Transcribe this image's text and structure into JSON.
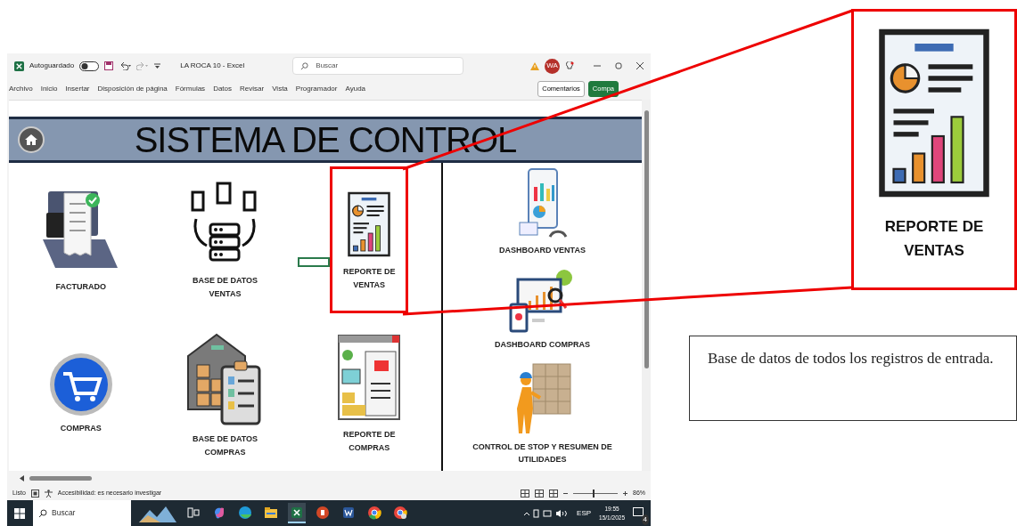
{
  "title_bar": {
    "autosave_label": "Autoguardado",
    "autosave_on": false,
    "document_title": "LA ROCA 10 - Excel",
    "search_placeholder": "Buscar",
    "avatar_initials": "WA"
  },
  "ribbon": {
    "tabs": [
      "Archivo",
      "Inicio",
      "Insertar",
      "Disposición de página",
      "Fórmulas",
      "Datos",
      "Revisar",
      "Vista",
      "Programador",
      "Ayuda"
    ],
    "buttons": [
      {
        "kind": "comments",
        "label": "Comentarios"
      },
      {
        "kind": "share",
        "label": "Compa"
      }
    ]
  },
  "sheet": {
    "banner_title": "SISTEMA DE CONTROL",
    "tiles": [
      {
        "kind": "invoice-laptop",
        "label": "FACTURADO",
        "highlighted": false
      },
      {
        "kind": "database-docs",
        "label": "BASE DE DATOS VENTAS",
        "highlighted": false
      },
      {
        "kind": "report",
        "label": "REPORTE DE VENTAS",
        "highlighted": true
      },
      {
        "kind": "cart",
        "label": "COMPRAS",
        "highlighted": false
      },
      {
        "kind": "warehouse",
        "label": "BASE DE DATOS COMPRAS",
        "highlighted": false
      },
      {
        "kind": "purchase-report",
        "label": "REPORTE DE COMPRAS",
        "highlighted": false
      }
    ],
    "side_tiles": [
      {
        "kind": "dashboard-phone",
        "label": "DASHBOARD VENTAS"
      },
      {
        "kind": "dashboard-monitor",
        "label": "DASHBOARD COMPRAS"
      },
      {
        "kind": "worker-boxes",
        "label": "CONTROL DE STOP Y RESUMEN DE UTILIDADES"
      }
    ]
  },
  "status_bar": {
    "status": "Listo",
    "accessibility": "Accesibilidad: es necesario investigar",
    "zoom_slider": {
      "level": 0.45
    },
    "zoom": "86%"
  },
  "taskbar": {
    "search": "Buscar",
    "apps": [
      {
        "kind": "task-view",
        "selected": false
      },
      {
        "kind": "copilot",
        "selected": false
      },
      {
        "kind": "edge",
        "selected": false
      },
      {
        "kind": "files",
        "selected": false
      },
      {
        "kind": "excel",
        "selected": true
      },
      {
        "kind": "powerpoint",
        "selected": false
      },
      {
        "kind": "word",
        "selected": false
      },
      {
        "kind": "chrome",
        "selected": false
      },
      {
        "kind": "chrome-profile",
        "selected": false
      }
    ],
    "language": "ESP",
    "time": "19:55",
    "date": "15/1/2025",
    "notifications": "4"
  },
  "callout": {
    "label_lines": [
      "REPORTE DE",
      "VENTAS"
    ]
  },
  "note": "Base de datos de todos los registros de entrada."
}
